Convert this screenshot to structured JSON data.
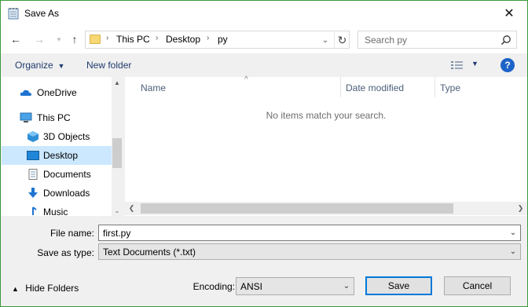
{
  "window": {
    "title": "Save As"
  },
  "address": {
    "crumbs": [
      "This PC",
      "Desktop",
      "py"
    ]
  },
  "search": {
    "placeholder": "Search py"
  },
  "commands": {
    "organize": "Organize",
    "new_folder": "New folder",
    "help": "?"
  },
  "navpane": {
    "items": [
      {
        "label": "OneDrive",
        "icon": "onedrive-icon"
      },
      {
        "label": "This PC",
        "icon": "computer-icon"
      },
      {
        "label": "3D Objects",
        "icon": "3d-objects-icon"
      },
      {
        "label": "Desktop",
        "icon": "desktop-icon",
        "selected": true
      },
      {
        "label": "Documents",
        "icon": "documents-icon"
      },
      {
        "label": "Downloads",
        "icon": "downloads-icon"
      },
      {
        "label": "Music",
        "icon": "music-icon"
      }
    ]
  },
  "columns": [
    "Name",
    "Date modified",
    "Type"
  ],
  "empty_message": "No items match your search.",
  "form": {
    "file_name_label": "File name:",
    "file_name_value": "first.py",
    "save_type_label": "Save as type:",
    "save_type_value": "Text Documents (*.txt)",
    "encoding_label": "Encoding:",
    "encoding_value": "ANSI"
  },
  "footer": {
    "hide_folders": "Hide Folders",
    "save": "Save",
    "cancel": "Cancel"
  },
  "colors": {
    "selected_bg": "#cce8ff",
    "accent": "#0078d7",
    "window_border": "#3c9a3c"
  }
}
